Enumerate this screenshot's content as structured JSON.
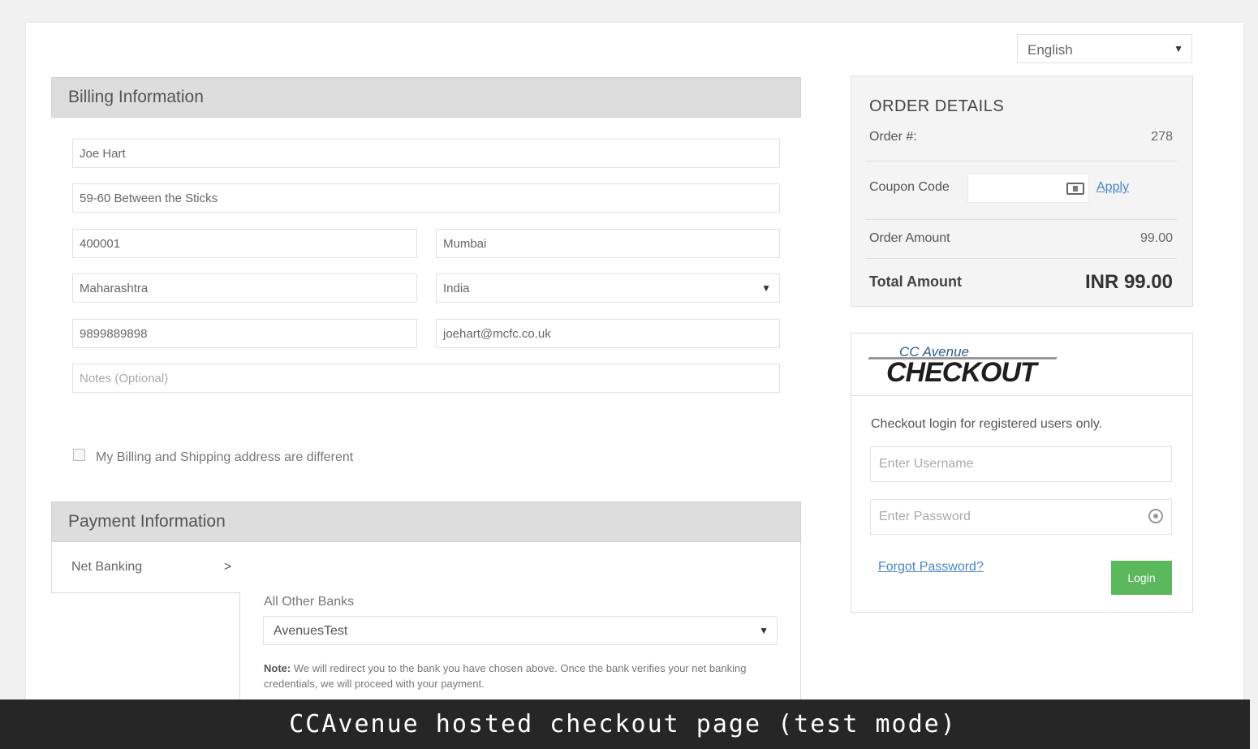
{
  "language": {
    "selected": "English"
  },
  "billing": {
    "title": "Billing Information",
    "name": "Joe Hart",
    "address": "59-60 Between the Sticks",
    "zip": "400001",
    "city": "Mumbai",
    "state": "Maharashtra",
    "country": "India",
    "phone": "9899889898",
    "email": "joehart@mcfc.co.uk",
    "notes_placeholder": "Notes (Optional)",
    "different_address_label": "My Billing and Shipping address are different"
  },
  "payment": {
    "title": "Payment Information",
    "tab_label": "Net Banking",
    "tab_arrow": ">",
    "bank_label": "All Other Banks",
    "bank_selected": "AvenuesTest",
    "note_bold": "Note:",
    "note_text": " We will redirect you to the bank you have chosen above. Once the bank verifies your net banking credentials, we will proceed with your payment."
  },
  "order": {
    "title": "ORDER DETAILS",
    "order_no_label": "Order #:",
    "order_no": "278",
    "coupon_label": "Coupon Code",
    "apply_label": "Apply",
    "amount_label": "Order  Amount",
    "amount": "99.00",
    "total_label": "Total Amount",
    "total": "INR 99.00"
  },
  "checkout_login": {
    "logo_small": "CC Avenue",
    "logo_main": "CHECKOUT",
    "note": "Checkout login for registered users only.",
    "username_placeholder": "Enter Username",
    "password_placeholder": "Enter Password",
    "forgot_label": "Forgot Password?",
    "login_label": "Login"
  },
  "caption": "CCAvenue hosted checkout page (test mode)"
}
